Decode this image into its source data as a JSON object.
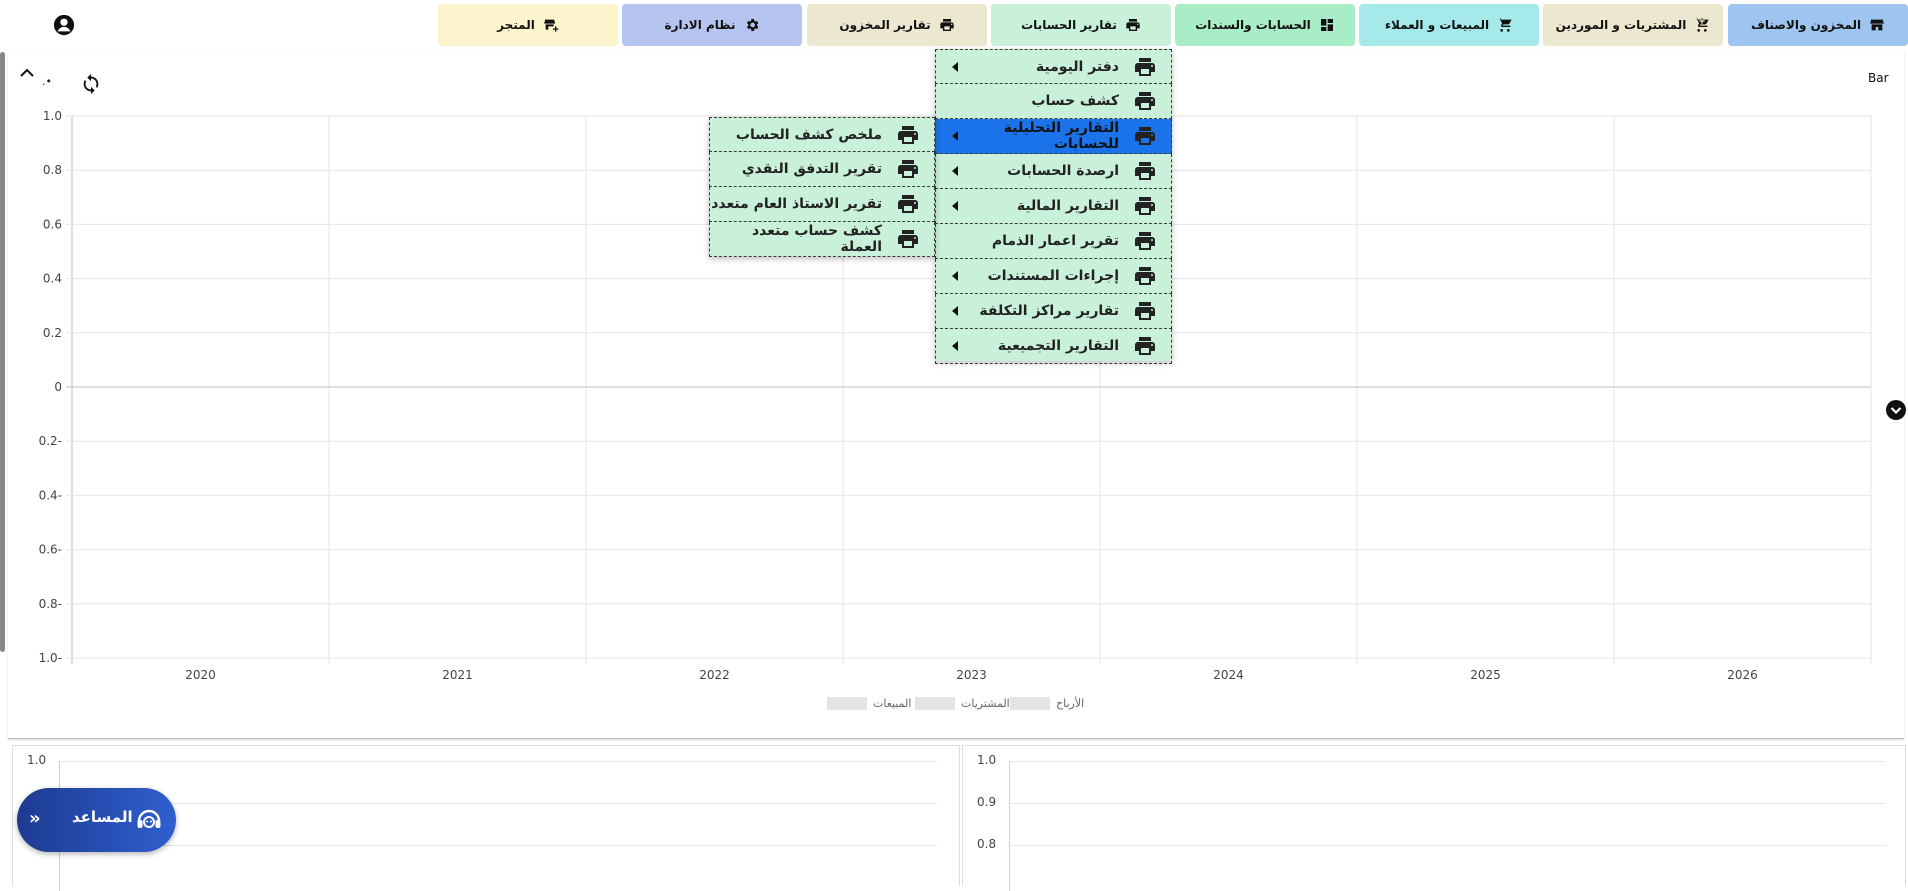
{
  "nav": {
    "tabs": [
      {
        "label": "المخزون والاصناف",
        "icon": "store-icon",
        "bg": "#9ec5f0"
      },
      {
        "label": "المشتريات و الموردين",
        "icon": "cart-plus-icon",
        "bg": "#ece7cf"
      },
      {
        "label": "المبيعات و العملاء",
        "icon": "cart-icon",
        "bg": "#a6e9ea"
      },
      {
        "label": "الحسابات والسندات",
        "icon": "dashboard-icon",
        "bg": "#a9edc6"
      },
      {
        "label": "تقارير الحسابات",
        "icon": "printer-icon",
        "bg": "#c9f0d8"
      },
      {
        "label": "تقارير المخزون",
        "icon": "printer-icon",
        "bg": "#ece7cf"
      },
      {
        "label": "نظام الادارة",
        "icon": "gear-icon",
        "bg": "#b5c5ef"
      },
      {
        "label": "المتجر",
        "icon": "store-add-icon",
        "bg": "#fbf4cc"
      }
    ]
  },
  "chart_controls": {
    "type_label": "Bar",
    "dot_label": ".•"
  },
  "chart_data": {
    "type": "bar",
    "categories": [
      "2020",
      "2021",
      "2022",
      "2023",
      "2024",
      "2025",
      "2026"
    ],
    "series": [
      {
        "name": "الأرباح",
        "values": []
      },
      {
        "name": "المشتريات",
        "values": []
      },
      {
        "name": "المبيعات",
        "values": []
      }
    ],
    "y_ticks": [
      "1.0",
      "0.8",
      "0.6",
      "0.4",
      "0.2",
      "0",
      "0.2-",
      "0.4-",
      "0.6-",
      "0.8-",
      "1.0-"
    ],
    "ylim": [
      -1,
      1
    ],
    "grid": true,
    "legend": "bottom",
    "legend_swatch_color": "#e4e4e4"
  },
  "bottom_left": {
    "y_ticks": [
      "1.0"
    ]
  },
  "bottom_right": {
    "y_ticks": [
      "1.0",
      "0.9",
      "0.8"
    ]
  },
  "assistant": {
    "label": "المساعد",
    "chevron": "»"
  },
  "menu": {
    "items": [
      {
        "label": "دفتر اليومية",
        "has_submenu": true
      },
      {
        "label": "كشف حساب",
        "has_submenu": false
      },
      {
        "label": "التقارير التحليلية للحسابات",
        "has_submenu": true,
        "active": true
      },
      {
        "label": "ارصدة الحسابات",
        "has_submenu": true
      },
      {
        "label": "التقارير المالية",
        "has_submenu": true
      },
      {
        "label": "تقرير اعمار الذمام",
        "has_submenu": false
      },
      {
        "label": "إجراءات المستندات",
        "has_submenu": true
      },
      {
        "label": "تقارير مراكز التكلفة",
        "has_submenu": true
      },
      {
        "label": "التقارير التجميعية",
        "has_submenu": true
      }
    ],
    "submenu": [
      {
        "label": "ملخص كشف الحساب"
      },
      {
        "label": "تقرير التدفق النقدي"
      },
      {
        "label": "تقرير الاستاذ العام متعدد"
      },
      {
        "label": "كشف حساب متعدد العملة"
      }
    ],
    "bg": "#c9f0d8",
    "active_bg": "#1a73e8"
  }
}
